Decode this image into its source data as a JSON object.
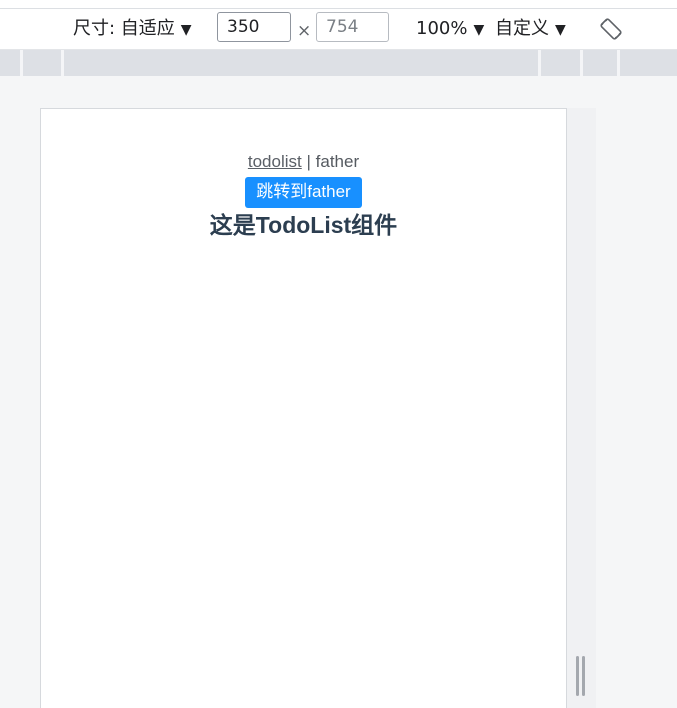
{
  "toolbar": {
    "dimension_label": "尺寸: 自适应",
    "width_value": "350",
    "height_value": "754",
    "times_symbol": "×",
    "zoom_label": "100%",
    "throttle_label": "自定义",
    "dropdown_arrow": "▼",
    "rotate_icon": "rotate-icon"
  },
  "app": {
    "nav": {
      "link_todolist": "todolist",
      "separator": "|",
      "link_father": "father"
    },
    "jump_button_label": "跳转到father",
    "heading": "这是TodoList组件",
    "accent_color": "#1890ff"
  }
}
